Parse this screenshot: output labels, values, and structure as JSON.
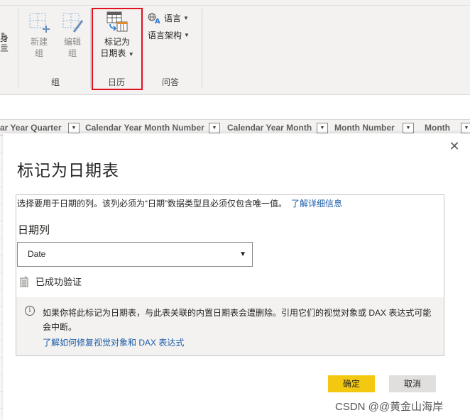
{
  "ribbon": {
    "left_partial": [
      "身",
      "亖"
    ],
    "new_group": "新建\n组",
    "new_group_l1": "新建",
    "new_group_l2": "组",
    "edit_group_l1": "编辑",
    "edit_group_l2": "组",
    "mark_l1": "标记为",
    "mark_l2": "日期表",
    "group_label_group": "组",
    "group_label_calendar": "日历",
    "group_label_qa": "问答",
    "language": "语言",
    "linguistic_schema": "语言架构"
  },
  "columns": [
    {
      "label": "ar Year Quarter"
    },
    {
      "label": "Calendar Year Month Number"
    },
    {
      "label": "Calendar Year Month"
    },
    {
      "label": "Month Number"
    },
    {
      "label": "Month"
    }
  ],
  "dialog": {
    "title": "标记为日期表",
    "description": "选择要用于日期的列。该列必须为“日期”数据类型且必须仅包含唯一值。",
    "learn_more": "了解详细信息",
    "field_label": "日期列",
    "selected_value": "Date",
    "validation": "已成功验证",
    "warning": "如果你将此标记为日期表，与此表关联的内置日期表会遭删除。引用它们的视觉对象或 DAX 表达式可能会中断。",
    "warning_link": "了解如何修复视觉对象和 DAX 表达式",
    "ok": "确定",
    "cancel": "取消",
    "colors": {
      "ok_bg": "#f2c811",
      "link": "#1a5ba6",
      "highlight": "#e3101f"
    }
  },
  "watermark": "CSDN @@黄金山海岸"
}
